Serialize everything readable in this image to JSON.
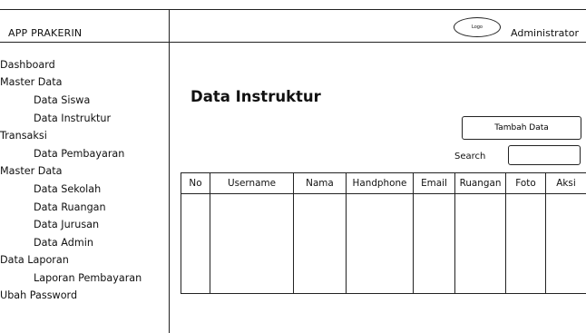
{
  "app": {
    "title": "APP PRAKERIN"
  },
  "header": {
    "logo_text": "Logo",
    "user_name": "Administrator"
  },
  "sidebar": {
    "items": [
      {
        "label": "Dashboard",
        "level": 0
      },
      {
        "label": "Master Data",
        "level": 0
      },
      {
        "label": "Data Siswa",
        "level": 1
      },
      {
        "label": "Data Instruktur",
        "level": 1
      },
      {
        "label": "Transaksi",
        "level": 0
      },
      {
        "label": "Data Pembayaran",
        "level": 1
      },
      {
        "label": "Master Data",
        "level": 0
      },
      {
        "label": "Data Sekolah",
        "level": 1
      },
      {
        "label": "Data Ruangan",
        "level": 1
      },
      {
        "label": "Data Jurusan",
        "level": 1
      },
      {
        "label": "Data Admin",
        "level": 1
      },
      {
        "label": "Data Laporan",
        "level": 0
      },
      {
        "label": "Laporan Pembayaran",
        "level": 1
      },
      {
        "label": "Ubah Password",
        "level": 0
      }
    ]
  },
  "main": {
    "page_title": "Data Instruktur",
    "add_button_label": "Tambah Data",
    "search_label": "Search",
    "search_value": "",
    "table": {
      "columns": [
        "No",
        "Username",
        "Nama",
        "Handphone",
        "Email",
        "Ruangan",
        "Foto",
        "Aksi"
      ],
      "rows": []
    }
  }
}
